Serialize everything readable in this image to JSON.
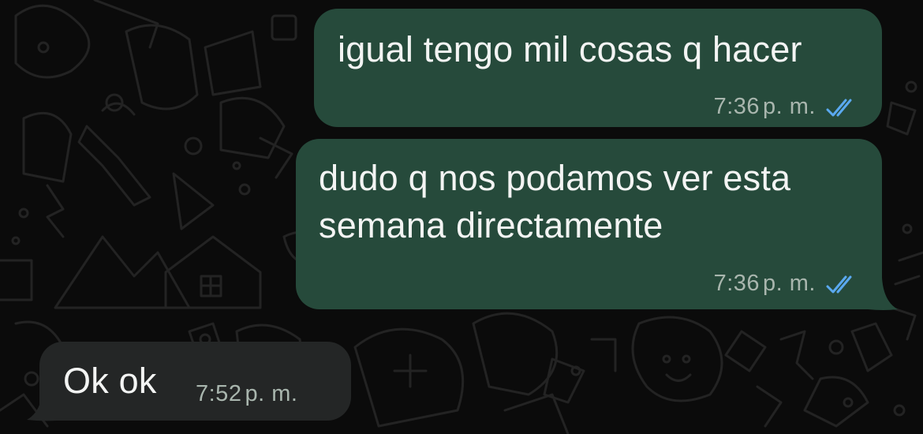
{
  "conversation": {
    "messages": [
      {
        "direction": "outgoing",
        "text": "igual tengo mil cosas q hacer",
        "time": "7:36",
        "period": "p. m.",
        "status": "read",
        "status_icon": "double-check-icon",
        "status_color": "#5aa9f0"
      },
      {
        "direction": "outgoing",
        "text": "dudo q nos podamos ver esta\nsemana directamente",
        "time": "7:36",
        "period": "p. m.",
        "status": "read",
        "status_icon": "double-check-icon",
        "status_color": "#5aa9f0"
      },
      {
        "direction": "incoming",
        "text": "Ok ok",
        "time": "7:52",
        "period": "p. m."
      }
    ]
  },
  "theme": {
    "background": "#0b0b0b",
    "outgoing_bubble": "#264a3b",
    "incoming_bubble": "#242626",
    "meta_text": "#a9b6ae"
  }
}
